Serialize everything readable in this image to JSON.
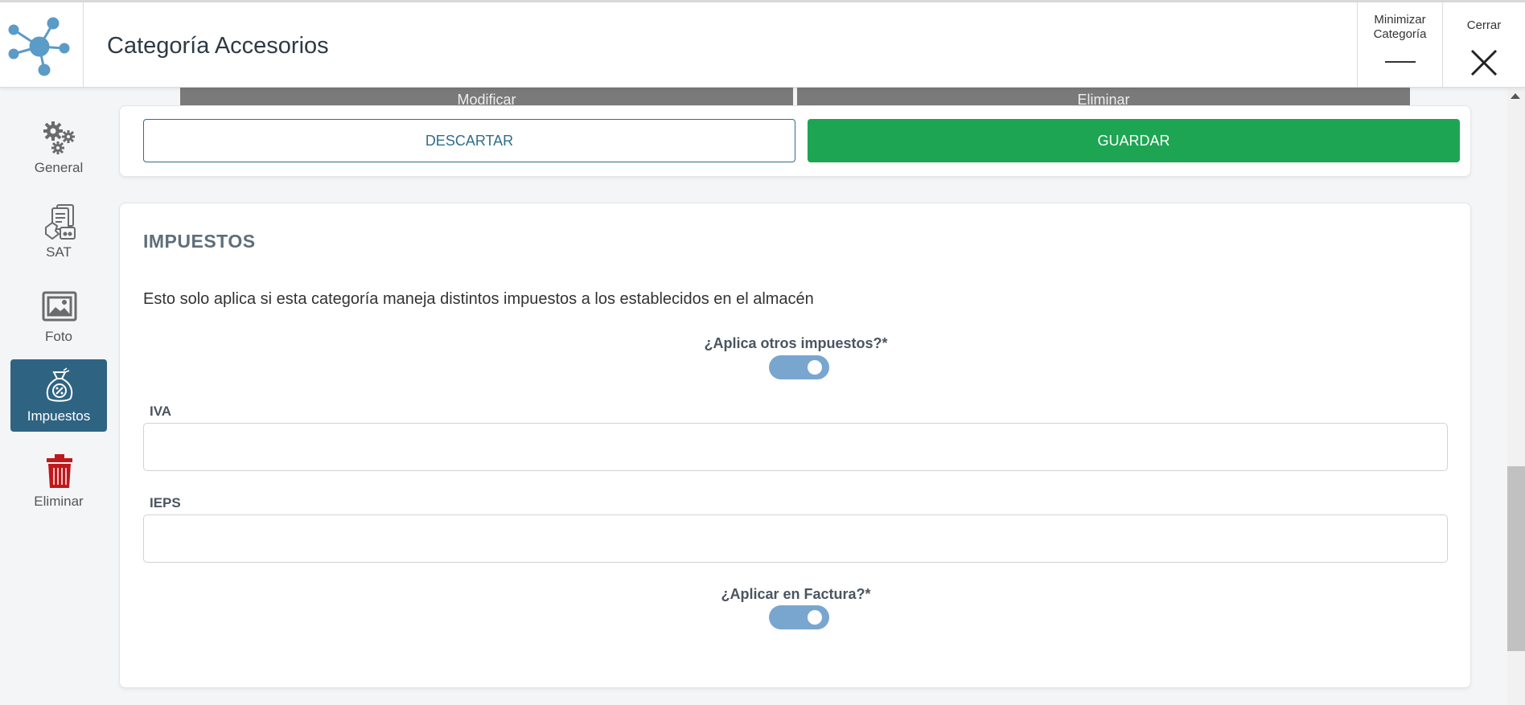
{
  "header": {
    "title": "Categoría Accesorios",
    "minimize_label_line1": "Minimizar",
    "minimize_label_line2": "Categoría",
    "close_label": "Cerrar"
  },
  "sidebar": {
    "items": [
      {
        "label": "General",
        "icon": "gears-icon"
      },
      {
        "label": "SAT",
        "icon": "documents-hand-icon"
      },
      {
        "label": "Foto",
        "icon": "photo-icon"
      },
      {
        "label": "Impuestos",
        "icon": "tax-bag-icon",
        "active": true
      },
      {
        "label": "Eliminar",
        "icon": "trash-icon"
      }
    ]
  },
  "behind_buttons": {
    "modify": "Modificar",
    "delete": "Eliminar"
  },
  "actions": {
    "discard": "DESCARTAR",
    "save": "GUARDAR"
  },
  "taxes": {
    "title": "IMPUESTOS",
    "description": "Esto solo aplica si esta categoría maneja distintos impuestos a los establecidos en el almacén",
    "other_taxes_label": "¿Aplica otros impuestos?*",
    "other_taxes_on": true,
    "iva_label": "IVA",
    "iva_value": "",
    "ieps_label": "IEPS",
    "ieps_value": "",
    "invoice_label": "¿Aplicar en Factura?*",
    "invoice_on": true
  },
  "colors": {
    "save": "#1ea553",
    "sidebar_active": "#2f6382",
    "toggle": "#79a6cf",
    "trash": "#c0181b"
  }
}
